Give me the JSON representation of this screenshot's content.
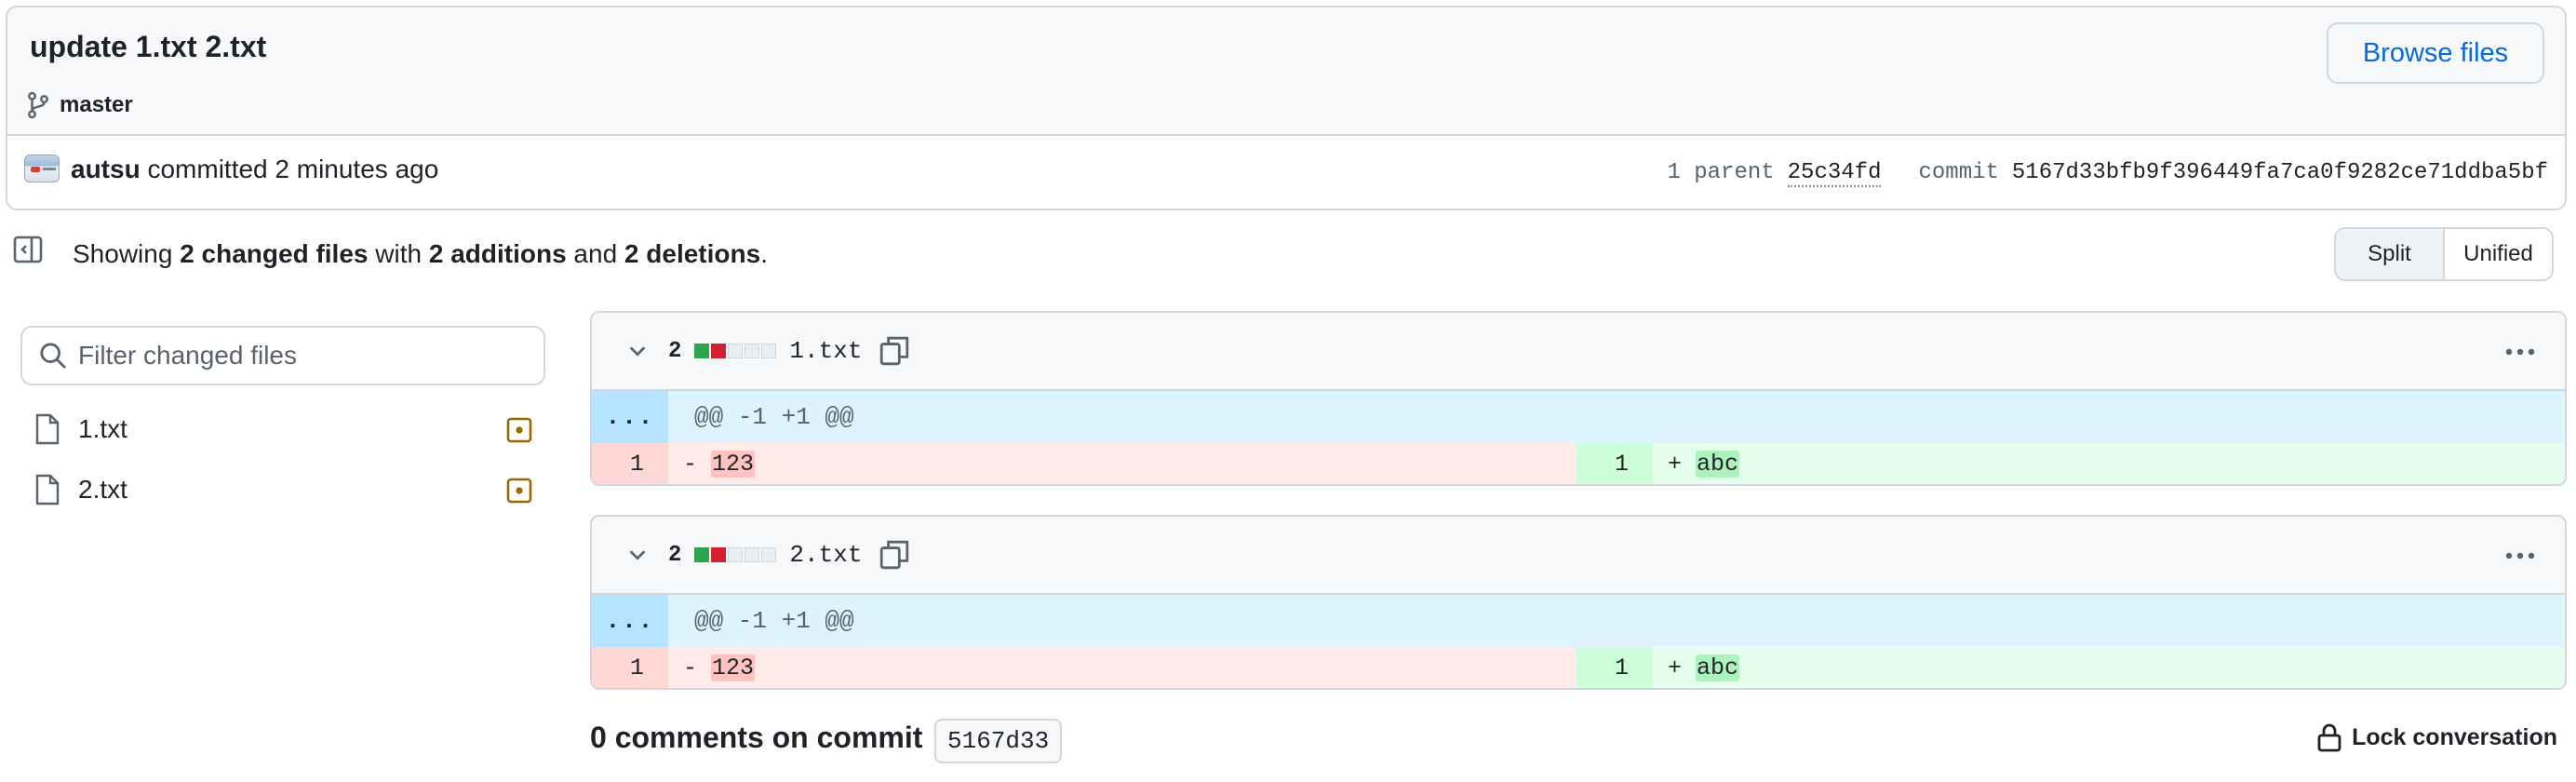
{
  "commit": {
    "title": "update 1.txt 2.txt",
    "branch": "master",
    "browse_label": "Browse files",
    "author": "autsu",
    "action_text": " committed 2 minutes ago",
    "parent_label": "1 parent",
    "parent_sha": "25c34fd",
    "commit_label": "commit",
    "commit_sha": "5167d33bfb9f396449fa7ca0f9282ce71ddba5bf"
  },
  "summary": {
    "prefix": "Showing ",
    "changed": "2 changed files",
    "mid1": " with ",
    "additions": "2 additions",
    "mid2": " and ",
    "deletions": "2 deletions",
    "suffix": "."
  },
  "view_toggle": {
    "split": "Split",
    "unified": "Unified",
    "selected": "Split"
  },
  "file_filter": {
    "placeholder": "Filter changed files",
    "value": ""
  },
  "file_tree": [
    {
      "name": "1.txt",
      "status": "modified"
    },
    {
      "name": "2.txt",
      "status": "modified"
    }
  ],
  "diffs": [
    {
      "file": "1.txt",
      "change_count": "2",
      "hunk_expand": "...",
      "hunk_header": "@@ -1 +1 @@",
      "left_line_num": "1",
      "left_sign": "-",
      "left_code": "123",
      "right_line_num": "1",
      "right_sign": "+",
      "right_code": "abc"
    },
    {
      "file": "2.txt",
      "change_count": "2",
      "hunk_expand": "...",
      "hunk_header": "@@ -1 +1 @@",
      "left_line_num": "1",
      "left_sign": "-",
      "left_code": "123",
      "right_line_num": "1",
      "right_sign": "+",
      "right_code": "abc"
    }
  ],
  "comments": {
    "title": "0 comments on commit",
    "sha": "5167d33",
    "lock_label": "Lock conversation"
  },
  "colors": {
    "link": "#0969da",
    "addition": "#2da44e",
    "deletion": "#cf222e",
    "modified_badge": "#9a6700"
  },
  "icons": [
    "git-branch-icon",
    "sidebar-toggle-icon",
    "search-icon",
    "file-icon",
    "file-modified-icon",
    "chevron-down-icon",
    "copy-icon",
    "kebab-icon",
    "lock-icon"
  ]
}
